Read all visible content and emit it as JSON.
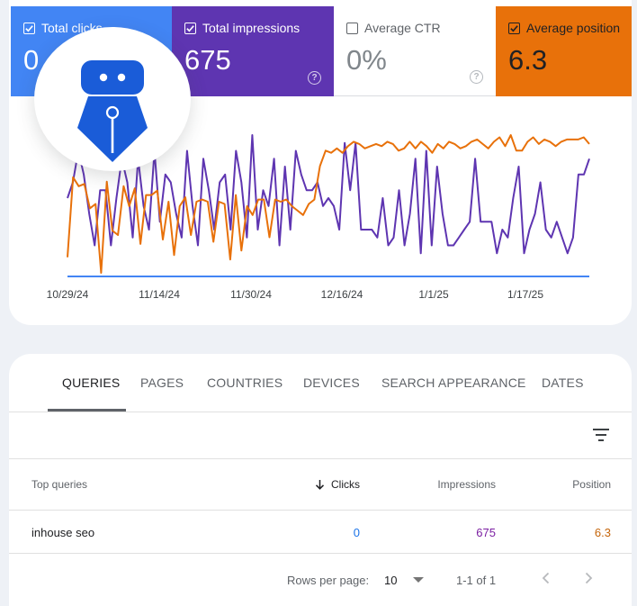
{
  "metrics": {
    "clicks": {
      "label": "Total clicks",
      "value": "0",
      "checked": true
    },
    "impressions": {
      "label": "Total impressions",
      "value": "675",
      "checked": true
    },
    "ctr": {
      "label": "Average CTR",
      "value": "0%",
      "checked": false
    },
    "position": {
      "label": "Average position",
      "value": "6.3",
      "checked": true
    },
    "help_glyph": "?"
  },
  "logo": {
    "icon": "fountain-pen-robot-logo",
    "color": "#1a5cd8"
  },
  "colors": {
    "clicks": "#4285f4",
    "impressions": "#5e35b1",
    "position": "#e8710a"
  },
  "chart_data": {
    "type": "line",
    "x_tick_labels": [
      "10/29/24",
      "11/14/24",
      "11/30/24",
      "12/16/24",
      "1/1/25",
      "1/17/25"
    ],
    "series": [
      {
        "name": "Total clicks",
        "color": "#4285f4",
        "values": [
          0,
          0,
          0,
          0,
          0,
          0,
          0,
          0,
          0,
          0,
          0,
          0,
          0,
          0,
          0,
          0,
          0,
          0,
          0,
          0,
          0,
          0,
          0,
          0,
          0,
          0,
          0,
          0,
          0,
          0,
          0,
          0,
          0,
          0,
          0,
          0,
          0,
          0,
          0,
          0,
          0,
          0,
          0,
          0,
          0,
          0,
          0,
          0,
          0,
          0,
          0,
          0,
          0,
          0,
          0,
          0,
          0,
          0,
          0,
          0,
          0,
          0,
          0,
          0,
          0,
          0,
          0,
          0,
          0,
          0,
          0,
          0,
          0,
          0,
          0,
          0,
          0,
          0,
          0,
          0,
          0,
          0,
          0,
          0,
          0,
          0,
          0,
          0,
          0,
          0,
          0,
          0,
          0
        ]
      },
      {
        "name": "Total impressions",
        "color": "#5e35b1",
        "values": [
          8,
          10,
          14,
          11,
          6,
          2,
          9,
          9,
          2,
          8,
          13,
          10,
          3,
          13,
          7,
          4,
          14,
          5,
          11,
          10,
          6,
          3,
          14,
          7,
          2,
          13,
          9,
          4,
          10,
          11,
          4,
          14,
          10,
          3,
          16,
          4,
          9,
          7,
          13,
          2,
          12,
          4,
          14,
          11,
          9,
          9,
          10,
          7,
          8,
          7,
          4,
          15,
          9,
          15,
          4,
          4,
          4,
          3,
          8,
          2,
          3,
          9,
          2,
          6,
          13,
          1,
          14,
          2,
          12,
          6,
          2,
          2,
          3,
          4,
          5,
          13,
          5,
          5,
          5,
          1,
          4,
          3,
          8,
          12,
          1,
          4,
          6,
          10,
          4,
          3,
          5,
          3,
          1,
          3,
          11,
          11,
          13
        ]
      },
      {
        "name": "Average position",
        "color": "#e8710a",
        "values": [
          9.2,
          5.6,
          6.0,
          5.9,
          7.0,
          6.8,
          9.9,
          5.8,
          8.0,
          8.2,
          6.0,
          6.9,
          6.1,
          8.6,
          6.4,
          6.4,
          6.2,
          8.4,
          6.7,
          9.1,
          6.9,
          6.5,
          8.2,
          6.7,
          6.6,
          6.7,
          8.5,
          6.7,
          6.8,
          9.3,
          6.4,
          8.9,
          6.9,
          7.3,
          6.6,
          6.6,
          8.3,
          6.6,
          6.7,
          6.6,
          6.9,
          7.1,
          7.3,
          6.8,
          6.6,
          5.1,
          4.4,
          4.5,
          4.3,
          4.5,
          4.2,
          4.0,
          4.1,
          4.3,
          4.2,
          4.1,
          4.2,
          4.0,
          4.1,
          4.4,
          4.3,
          4.0,
          4.3,
          4.0,
          4.2,
          4.5,
          4.1,
          4.3,
          4.0,
          4.1,
          4.3,
          4.2,
          4.0,
          3.9,
          4.1,
          4.3,
          4.0,
          3.8,
          4.2,
          3.7,
          4.4,
          4.4,
          4.0,
          3.8,
          4.1,
          3.9,
          4.0,
          4.2,
          4.0,
          3.9,
          3.9,
          3.9,
          3.8,
          4.1
        ]
      }
    ],
    "grid": false
  },
  "tabs": [
    {
      "label": "QUERIES",
      "active": true
    },
    {
      "label": "PAGES",
      "active": false
    },
    {
      "label": "COUNTRIES",
      "active": false
    },
    {
      "label": "DEVICES",
      "active": false
    },
    {
      "label": "SEARCH APPEARANCE",
      "active": false
    },
    {
      "label": "DATES",
      "active": false
    }
  ],
  "table": {
    "headers": {
      "query": "Top queries",
      "clicks": "Clicks",
      "impressions": "Impressions",
      "position": "Position"
    },
    "sort": {
      "column": "clicks",
      "direction": "descending"
    },
    "rows": [
      {
        "query": "inhouse seo",
        "clicks": "0",
        "impressions": "675",
        "position": "6.3"
      }
    ]
  },
  "pagination": {
    "rows_per_page_label": "Rows per page:",
    "rows_per_page": "10",
    "range": "1-1 of 1"
  }
}
